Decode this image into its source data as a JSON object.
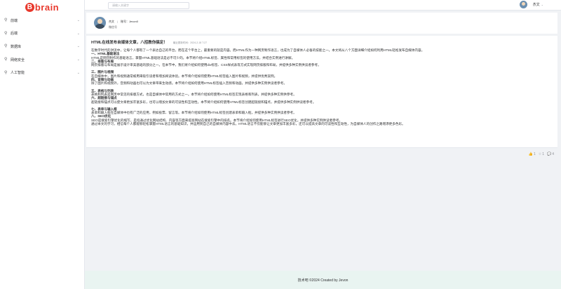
{
  "brand": {
    "mark": "B",
    "name": "brain"
  },
  "sidebar": {
    "items": [
      {
        "icon": "location-icon",
        "label": "前端"
      },
      {
        "icon": "location-icon",
        "label": "后端"
      },
      {
        "icon": "location-icon",
        "label": "数据库"
      },
      {
        "icon": "location-icon",
        "label": "网络安全"
      },
      {
        "icon": "location-icon",
        "label": "人工智能"
      }
    ]
  },
  "header": {
    "search_placeholder": "请输入关键字",
    "username": "杰文"
  },
  "author": {
    "name": "杰文",
    "account_label": "账号：Jevon0",
    "follow_label": "微信号"
  },
  "article": {
    "title": "HTML在线发布自媒体文章，八招教你搞定！",
    "updated": "最近更新时间：2024-2-18 7:27",
    "paragraphs": [
      {
        "text": "在数字时代的洪流中，让每个人都有了一个表达自己的平台，而在这个平台上，最重要的就是内容。而HTML作为一种网页制作语言，也成为了自媒体人必备的技能之一。本文将从八个方面详细介绍如何利用HTML轻松发布自媒体内容。",
        "bold": false
      },
      {
        "text": "一、HTML基础语法",
        "bold": true
      },
      {
        "text": "HTML是网页制作的基础语言，掌握HTML基础语法是必不可少的。本节将介绍HTML标签、属性和常用标签的使用方法，并结合实例进行讲解。",
        "bold": false
      },
      {
        "text": "二、排版与布局",
        "bold": true
      },
      {
        "text": "网页排版与布局是展示设计审美基础的部分之一。在本节中，我们将介绍如何使用div标签、CSS样式表等方式实现网页排版和布局，并提供多种实例供读者参考。",
        "bold": false
      },
      {
        "text": "",
        "bold": false
      },
      {
        "text": "三、图片与视频",
        "bold": true
      },
      {
        "text": "在自媒体中，图片和视频通常被用来吸引读者和增加阅读体验。本节将介绍如何使用HTML标签插入图片和视频，并提供优秀案例。",
        "bold": false
      },
      {
        "text": "四、音频与动画",
        "bold": true
      },
      {
        "text": "除了图片和视频外，音频和动画也可以为文章带来生动感。本节将介绍如何使用HTML标签插入音频和动画，并提供多种实例供读者参考。",
        "bold": false
      },
      {
        "text": "",
        "bold": false
      },
      {
        "text": "五、表格与列表",
        "bold": true
      },
      {
        "text": "表格和列表是网页中常见的排版方式，也是自媒体中常用的方式之一。本节将介绍如何使用HTML标签实现表格和列表，并提供多种实例供参考。",
        "bold": false
      },
      {
        "text": "六、超链接与锚点",
        "bold": true
      },
      {
        "text": "超链接和锚点可以使文章更加丰富多彩，也可以增加文章的可读性和互动性。本节将介绍如何使用HTML标签创建超链接和锚点，并提供多种实例供读者参考。",
        "bold": false
      },
      {
        "text": "",
        "bold": false
      },
      {
        "text": "七、表单与输入框",
        "bold": true
      },
      {
        "text": "表单和输入框在自媒体中也有广泛的应用，例如投票、留言等。本节将介绍如何使用HTML标签创建表单和输入框，并提供多种实例供读者参考。",
        "bold": false
      },
      {
        "text": "八、SEO优化",
        "bold": true
      },
      {
        "text": "SEO是搜索引擎优化的缩写，是指通过优化网站结构、内容等方面来提高网站在搜索引擎中的排名。本节将介绍如何使用HTML标签进行SEO优化，并提供多种实例供读者参考。",
        "bold": false
      },
      {
        "text": "通过本文的学习，相信每个人都能够轻松掌握HTML语言的基础知识，并运用到自己的自媒体内容中去。HTML语言不仅能够让文章更加丰富多彩，还可以提高文章的可读性和互动性，为自媒体人的创作之路增添更多色彩。",
        "bold": false
      }
    ]
  },
  "stats": {
    "likes": "1",
    "stars": "1",
    "comments": "4"
  },
  "footer": {
    "text": "技术吧 ©2024 Created by Jevon"
  },
  "colors": {
    "brand": "#e8382c",
    "footer_bg": "#e9f4f1",
    "page_bg": "#f0f2f5"
  }
}
